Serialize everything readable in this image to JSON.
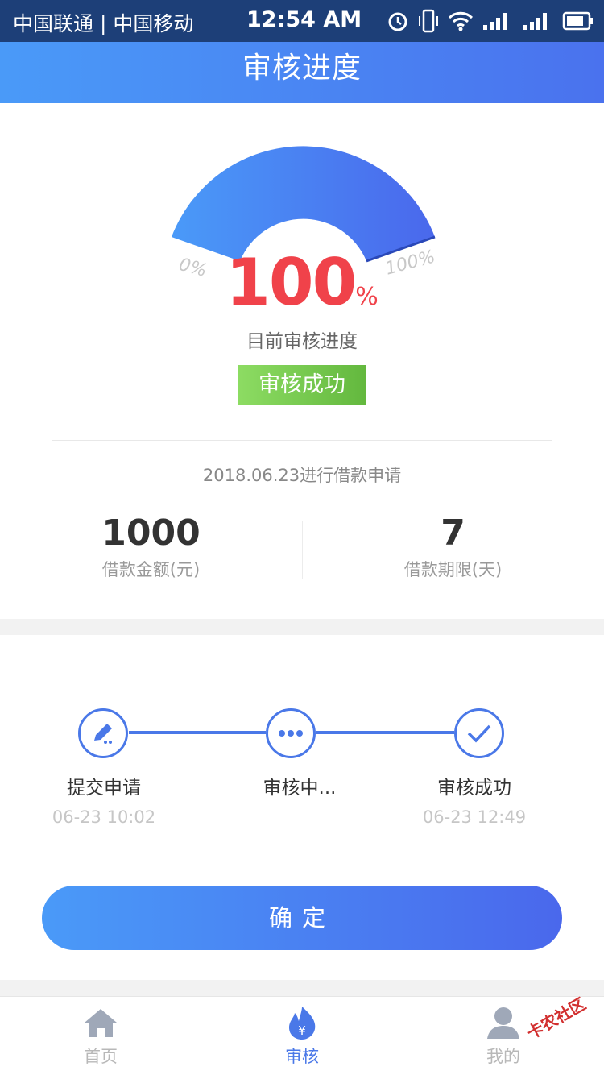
{
  "status_bar": {
    "carrier": "中国联通 | 中国移动",
    "time": "12:54 AM",
    "icons": [
      "alarm-icon",
      "vibrate-icon",
      "wifi-icon",
      "signal-1-icon",
      "signal-2-icon",
      "battery-icon"
    ]
  },
  "header": {
    "title": "审核进度"
  },
  "progress": {
    "value": 100,
    "value_text": "100",
    "unit": "%",
    "min_label": "0%",
    "max_label": "100%",
    "caption": "目前审核进度",
    "status": "审核成功"
  },
  "loan": {
    "apply_text": "2018.06.23进行借款申请",
    "amount_value": "1000",
    "amount_label": "借款金额(元)",
    "term_value": "7",
    "term_label": "借款期限(天)"
  },
  "steps": [
    {
      "label": "提交申请",
      "time": "06-23 10:02",
      "icon": "pencil-icon"
    },
    {
      "label": "审核中...",
      "time": "",
      "icon": "ellipsis-icon"
    },
    {
      "label": "审核成功",
      "time": "06-23 12:49",
      "icon": "check-icon"
    }
  ],
  "confirm_label": "确定",
  "tabbar": {
    "items": [
      {
        "label": "首页",
        "icon": "home-icon",
        "active": false
      },
      {
        "label": "审核",
        "icon": "fire-yen-icon",
        "active": true
      },
      {
        "label": "我的",
        "icon": "user-icon",
        "active": false
      }
    ]
  },
  "watermark": "卡农社区",
  "colors": {
    "primary": "#4a78e8",
    "percent_red": "#f0424a",
    "success_green": "#6cc047"
  }
}
